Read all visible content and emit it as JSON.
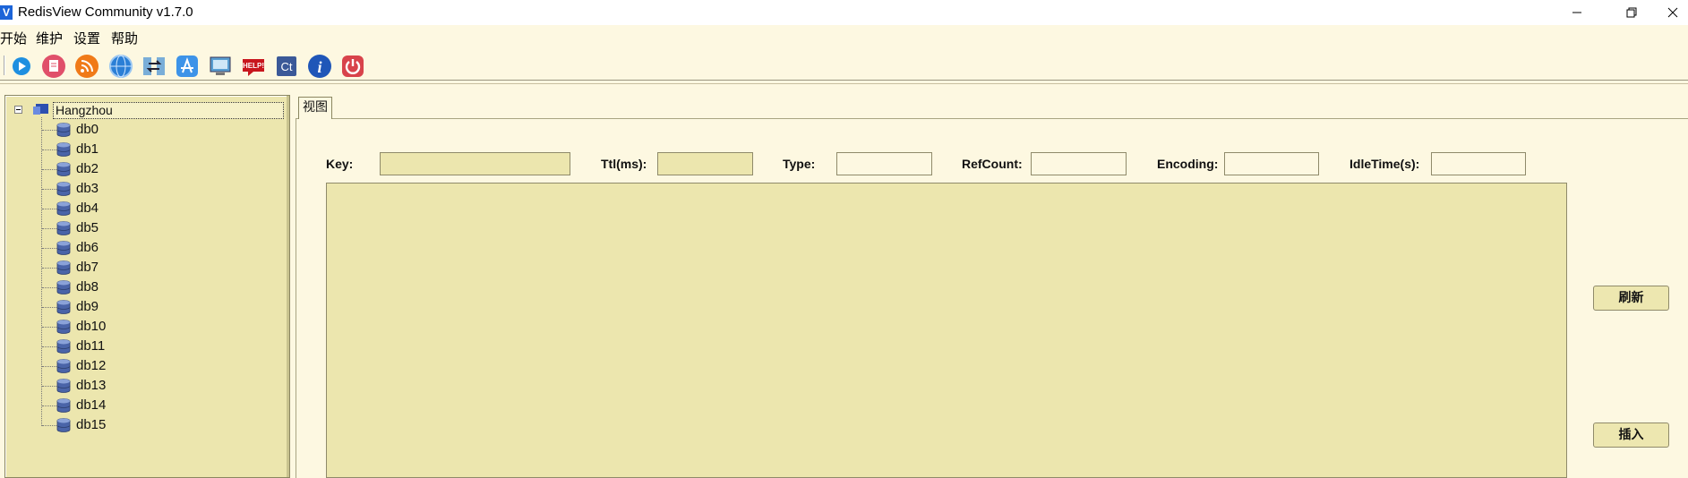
{
  "window": {
    "title": "RedisView Community v1.7.0",
    "icon": "app-logo-icon",
    "controls": [
      "minimize-icon",
      "restore-icon",
      "close-icon"
    ]
  },
  "menu": [
    "开始",
    "维护",
    "设置",
    "帮助"
  ],
  "toolbar": {
    "buttons": [
      {
        "name": "play-icon"
      },
      {
        "name": "document-icon"
      },
      {
        "name": "rss-icon"
      },
      {
        "name": "globe-icon"
      },
      {
        "name": "transfer-icon"
      },
      {
        "name": "app-store-icon"
      },
      {
        "name": "monitor-icon"
      },
      {
        "name": "help-icon",
        "text": "HELP!"
      },
      {
        "name": "ct-icon",
        "text": "Ct"
      },
      {
        "name": "info-icon",
        "text": "i"
      },
      {
        "name": "power-icon"
      }
    ]
  },
  "tree": {
    "root": "Hangzhou",
    "dbs": [
      "db0",
      "db1",
      "db2",
      "db3",
      "db4",
      "db5",
      "db6",
      "db7",
      "db8",
      "db9",
      "db10",
      "db11",
      "db12",
      "db13",
      "db14",
      "db15"
    ]
  },
  "tabs": {
    "view": "视图"
  },
  "fields": {
    "key": {
      "label": "Key:",
      "value": ""
    },
    "ttl": {
      "label": "Ttl(ms):",
      "value": ""
    },
    "type": {
      "label": "Type:",
      "value": ""
    },
    "refcount": {
      "label": "RefCount:",
      "value": ""
    },
    "encoding": {
      "label": "Encoding:",
      "value": ""
    },
    "idletime": {
      "label": "IdleTime(s):",
      "value": ""
    }
  },
  "buttons": {
    "refresh": "刷新",
    "insert": "插入"
  },
  "colors": {
    "background": "#fdf8e1",
    "panel": "#ece6ae",
    "border": "#8f8a6a"
  }
}
